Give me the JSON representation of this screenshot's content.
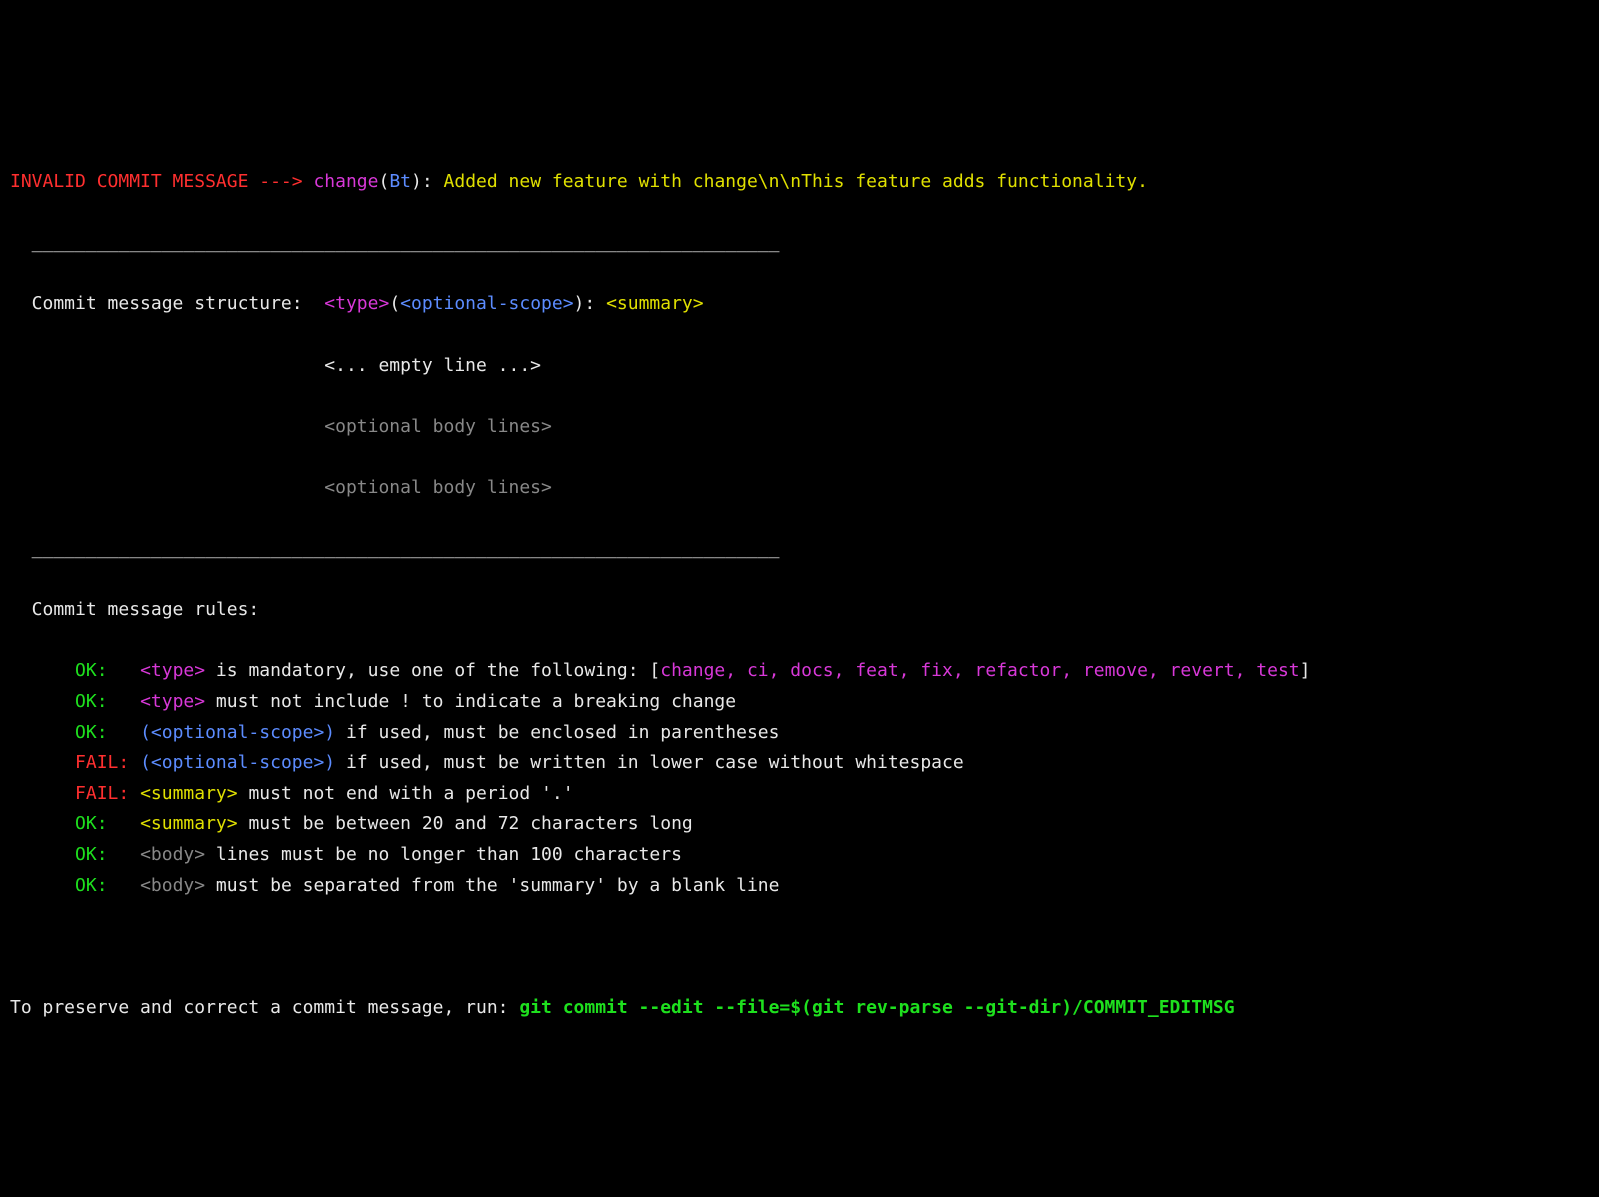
{
  "header": {
    "prefix": "INVALID COMMIT MESSAGE ---> ",
    "type": "change",
    "lp": "(",
    "scope": "Bt",
    "rp_colon": "): ",
    "rest": "Added new feature with change\\n\\nThis feature adds functionality."
  },
  "hr": "  _____________________________________________________________________",
  "structure": {
    "label": "  Commit message structure:  ",
    "type": "<type>",
    "lp": "(",
    "scope": "<optional-scope>",
    "rp_colon": "): ",
    "summary": "<summary>",
    "indent": "                             ",
    "empty": "<... empty line ...>",
    "body": "<optional body lines>"
  },
  "rules_label": "  Commit message rules:",
  "rules": [
    {
      "status": "OK",
      "segs": [
        {
          "cls": "magenta",
          "t": "<type>"
        },
        {
          "cls": "white",
          "t": " is mandatory, use one of the following: ["
        },
        {
          "cls": "magenta",
          "t": "change, ci, docs, feat, fix, refactor, remove, revert, test"
        },
        {
          "cls": "white",
          "t": "]"
        }
      ]
    },
    {
      "status": "OK",
      "segs": [
        {
          "cls": "magenta",
          "t": "<type>"
        },
        {
          "cls": "white",
          "t": " must not include ! to indicate a breaking change"
        }
      ]
    },
    {
      "status": "OK",
      "segs": [
        {
          "cls": "blue",
          "t": "(<optional-scope>)"
        },
        {
          "cls": "white",
          "t": " if used, must be enclosed in parentheses"
        }
      ]
    },
    {
      "status": "FAIL",
      "segs": [
        {
          "cls": "blue",
          "t": "(<optional-scope>)"
        },
        {
          "cls": "white",
          "t": " if used, must be written in lower case without whitespace"
        }
      ]
    },
    {
      "status": "FAIL",
      "segs": [
        {
          "cls": "yellow",
          "t": "<summary>"
        },
        {
          "cls": "white",
          "t": " must not end with a period '.'"
        }
      ]
    },
    {
      "status": "OK",
      "segs": [
        {
          "cls": "yellow",
          "t": "<summary>"
        },
        {
          "cls": "white",
          "t": " must be between 20 and 72 characters long"
        }
      ]
    },
    {
      "status": "OK",
      "segs": [
        {
          "cls": "grey",
          "t": "<body>"
        },
        {
          "cls": "white",
          "t": " lines must be no longer than 100 characters"
        }
      ]
    },
    {
      "status": "OK",
      "segs": [
        {
          "cls": "grey",
          "t": "<body>"
        },
        {
          "cls": "white",
          "t": " must be separated from the 'summary' by a blank line"
        }
      ]
    }
  ],
  "footer": {
    "label": "To preserve and correct a commit message, run: ",
    "cmd": "git commit --edit --file=$(git rev-parse --git-dir)/COMMIT_EDITMSG"
  }
}
